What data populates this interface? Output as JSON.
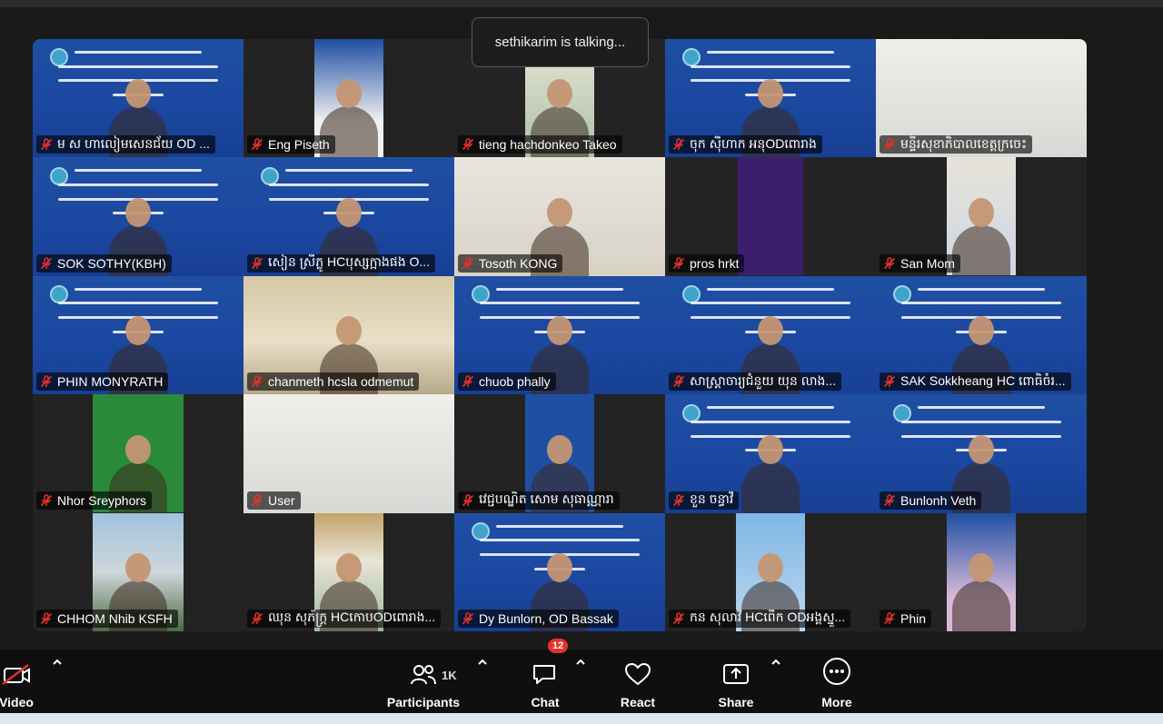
{
  "talking_indicator": "sethikarim is talking...",
  "participants": [
    {
      "name": "ម ស ហាលៀមសេនជ័យ  OD ...",
      "bg": "slide"
    },
    {
      "name": "Eng Piseth",
      "bg": "narrowslide2"
    },
    {
      "name": "tieng hachdonkeo Takeo",
      "bg": "narrowphoto"
    },
    {
      "name": "ចុក ស៊ីហាក អនុODពោរាង",
      "bg": "slide"
    },
    {
      "name": "មន្ទីរសុខាភិបាលខេត្តក្រចេះ",
      "bg": "room2"
    },
    {
      "name": "SOK SOTHY(KBH)",
      "bg": "slide"
    },
    {
      "name": "សៀន ស្រីភ្លូ HCបុស្សក្អាងផង O...",
      "bg": "slide"
    },
    {
      "name": "Tosoth KONG",
      "bg": "room"
    },
    {
      "name": "pros hrkt",
      "bg": "purple"
    },
    {
      "name": "San Mom",
      "bg": "sanmom"
    },
    {
      "name": "PHIN MONYRATH",
      "bg": "slide"
    },
    {
      "name": "chanmeth hcsla odmemut",
      "bg": "clinic"
    },
    {
      "name": "chuob phally",
      "bg": "slide"
    },
    {
      "name": "សាស្ត្រាចារ្យជំនួយ យុន លាង...",
      "bg": "slide"
    },
    {
      "name": "SAK Sokkheang HC ពោធិចំរ...",
      "bg": "slide"
    },
    {
      "name": "Nhor Sreyphors",
      "bg": "green"
    },
    {
      "name": "User",
      "bg": "room2"
    },
    {
      "name": "វេជ្ជបណ្ឌិត សោម សុធាណ្ណារា",
      "bg": "narrowslide"
    },
    {
      "name": "ខួន ចន្ធាវី",
      "bg": "slide"
    },
    {
      "name": "Bunlonh Veth",
      "bg": "slide"
    },
    {
      "name": "CHHOM Nhib KSFH",
      "bg": "building"
    },
    {
      "name": "ឈុន សុភ័ក្ត្រ HCកោបODពោរាង...",
      "bg": "narrowphoto2"
    },
    {
      "name": "Dy Bunlorn, OD Bassak",
      "bg": "slide"
    },
    {
      "name": "កន សុលាវី HCពើក ODអង្គស្នួ...",
      "bg": "hospital"
    },
    {
      "name": "Phin",
      "bg": "phin"
    }
  ],
  "toolbar": {
    "video_label": "Video",
    "participants_label": "Participants",
    "participants_count": "1K",
    "chat_label": "Chat",
    "chat_badge": "12",
    "react_label": "React",
    "share_label": "Share",
    "more_label": "More"
  },
  "colors": {
    "accent_red": "#e5312b",
    "slide_blue": "#1f4fa3",
    "toolbar_bg": "#0f0f0f"
  }
}
